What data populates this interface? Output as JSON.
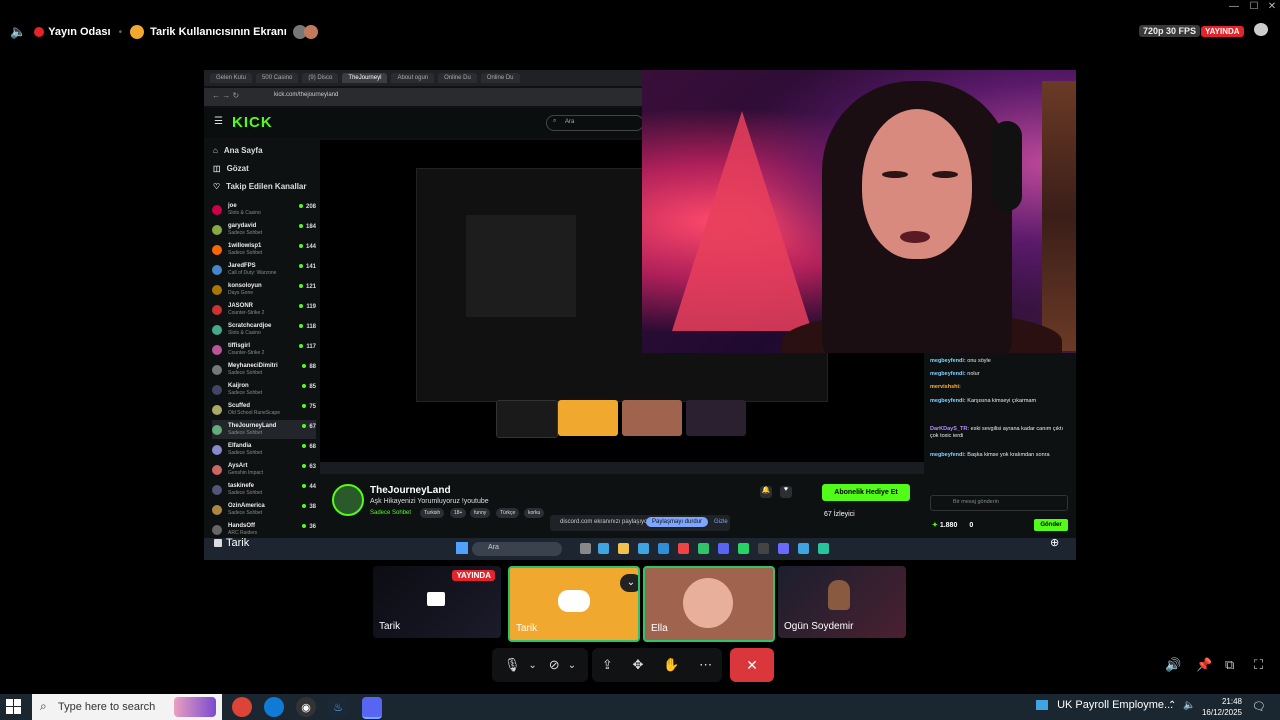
{
  "header": {
    "channel_name": "Yayın Odası",
    "screen_title": "Tarik Kullanıcısının Ekranı",
    "quality": "720p 30 FPS",
    "live_badge": "YAYINDA"
  },
  "browser": {
    "tabs": [
      "Gelen Kutu",
      "500 Casino",
      "(9) Disco",
      "TheJourneyl",
      "About ogun",
      "Online Du",
      "Online Du"
    ],
    "url": "kick.com/thejourneyland"
  },
  "kick": {
    "logo": "KICK",
    "search_placeholder": "Ara",
    "nav": [
      "Ana Sayfa",
      "Gözat",
      "Takip Edilen Kanallar"
    ],
    "channels": [
      {
        "name": "joe",
        "game": "Slots & Casino",
        "viewers": "208"
      },
      {
        "name": "garydavid",
        "game": "Sadece Sohbet",
        "viewers": "184"
      },
      {
        "name": "1willowisp1",
        "game": "Sadece Sohbet",
        "viewers": "144"
      },
      {
        "name": "JaredFPS",
        "game": "Call of Duty: Warzone",
        "viewers": "141"
      },
      {
        "name": "konsoloyun",
        "game": "Days Gone",
        "viewers": "121"
      },
      {
        "name": "JASONR",
        "game": "Counter-Strike 2",
        "viewers": "119"
      },
      {
        "name": "Scratchcardjoe",
        "game": "Slots & Casino",
        "viewers": "118"
      },
      {
        "name": "tiffisgirl",
        "game": "Counter-Strike 2",
        "viewers": "117"
      },
      {
        "name": "MeyhaneciDimitri",
        "game": "Sadece Sohbet",
        "viewers": "88"
      },
      {
        "name": "Kaijron",
        "game": "Sadece Sohbet",
        "viewers": "85"
      },
      {
        "name": "Scuffed",
        "game": "Old School RuneScape",
        "viewers": "75"
      },
      {
        "name": "TheJourneyLand",
        "game": "Sadece Sohbet",
        "viewers": "67"
      },
      {
        "name": "Elfandia",
        "game": "Sadece Sohbet",
        "viewers": "68"
      },
      {
        "name": "AysArt",
        "game": "Genshin Impact",
        "viewers": "63"
      },
      {
        "name": "taskinefe",
        "game": "Sadece Sohbet",
        "viewers": "44"
      },
      {
        "name": "OzinAmerica",
        "game": "Sadece Sohbet",
        "viewers": "38"
      },
      {
        "name": "HandsOff",
        "game": "ARC Raiders",
        "viewers": "36"
      }
    ],
    "streamer": {
      "name": "TheJourneyLand",
      "title": "Aşk Hikayenizi Yorumluyoruz !youtube",
      "category": "Sadece Sohbet",
      "tags": [
        "Turkish",
        "18+",
        "funny",
        "Türkçe",
        "korku"
      ],
      "subscribe_label": "Abonelik Hediye Et",
      "viewers": "67 İzleyici"
    },
    "share_tip": {
      "text": "discord.com ekranınızı paylaşıyor.",
      "stop_label": "Paylaşmayı durdur",
      "hide_label": "Gizle"
    },
    "chat": {
      "messages": [
        {
          "user": "megbeyfendi:",
          "text": "onu söyle"
        },
        {
          "user": "megbeyfendi:",
          "text": "nolur"
        },
        {
          "user": "mervishshi:",
          "text": ""
        },
        {
          "user": "megbeyfendi:",
          "text": "Karşısına kimseyi çıkarmam"
        },
        {
          "user": "DarKDayS_TR:",
          "text": "eski sevgilisi ayrana kadar canım çıktı çok toxic ierdi"
        },
        {
          "user": "megbeyfendi:",
          "text": "Başka kimse yok kralımdan sonra"
        }
      ],
      "input_placeholder": "Bir mesaj gönderin",
      "points": "1.880",
      "count": "0",
      "send_label": "Gönder"
    }
  },
  "inner_taskbar": {
    "search_label": "Ara",
    "app_label": "UK Payroll Employme..."
  },
  "presenter": "Tarik",
  "tiles": [
    {
      "name": "Tarik",
      "badge": "YAYINDA"
    },
    {
      "name": "Tarik"
    },
    {
      "name": "Ella"
    },
    {
      "name": "Ogün Soydemir"
    }
  ],
  "taskbar": {
    "search_placeholder": "Type here to search",
    "news": "UK Payroll Employme...",
    "time": "21:48",
    "date": "16/12/2025"
  },
  "colors": {
    "kick_green": "#53fc18",
    "live_red": "#e3242b",
    "end_call_red": "#da373c",
    "discord_yellow": "#f0a92e"
  }
}
